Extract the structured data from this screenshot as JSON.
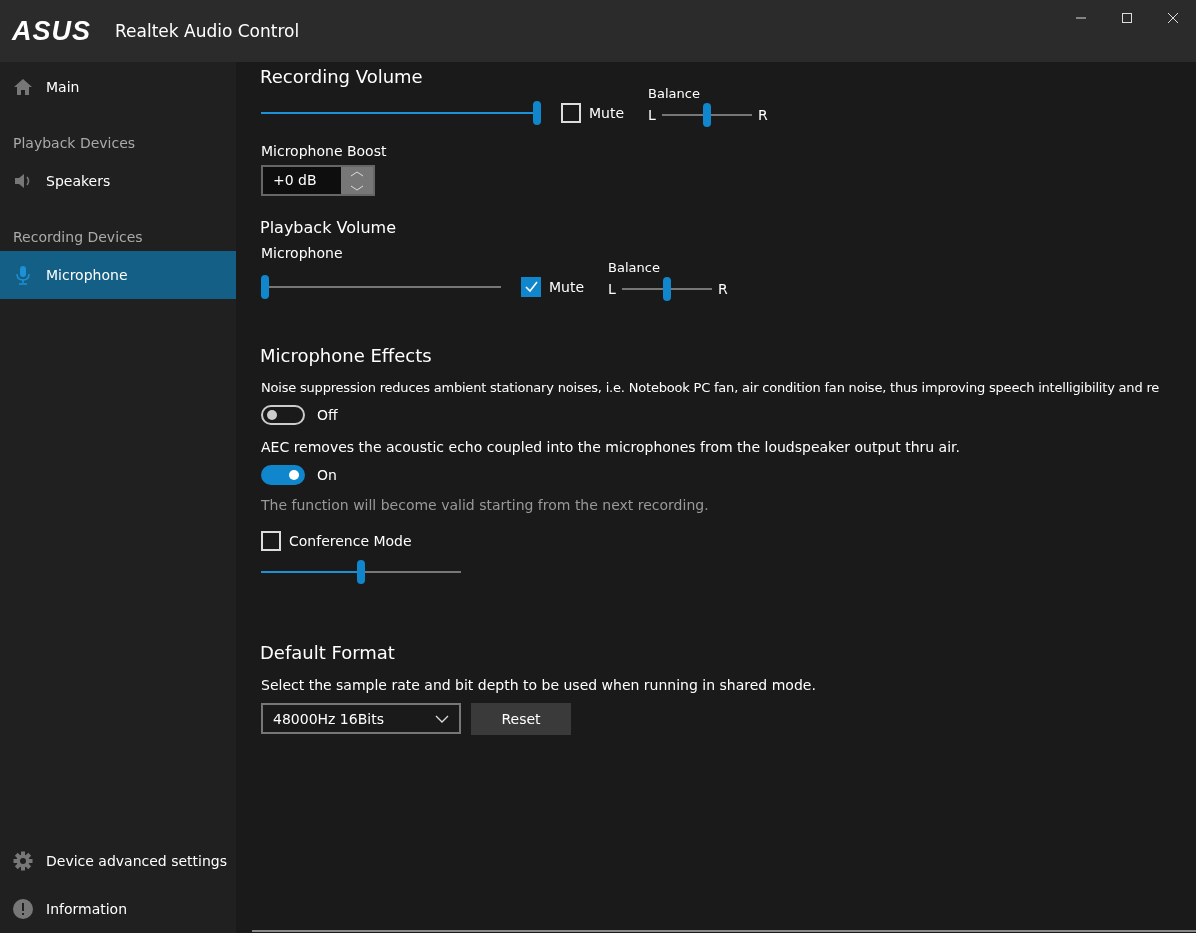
{
  "window": {
    "logo": "ASUS",
    "title": "Realtek Audio Control"
  },
  "sidebar": {
    "items": [
      {
        "kind": "link",
        "label": "Main",
        "selected": false
      },
      {
        "kind": "header",
        "label": "Playback Devices"
      },
      {
        "kind": "link",
        "label": "Speakers",
        "selected": false
      },
      {
        "kind": "header",
        "label": "Recording Devices"
      },
      {
        "kind": "link",
        "label": "Microphone",
        "selected": true
      }
    ],
    "bottom_items": [
      {
        "label": "Device advanced settings",
        "selected": false
      },
      {
        "label": "Information",
        "selected": false
      }
    ]
  },
  "recording_volume": {
    "title": "Recording Volume",
    "level": 1.0,
    "mute": {
      "label": "Mute",
      "checked": false
    },
    "balance": {
      "label": "Balance",
      "left": "L",
      "right": "R",
      "level": 0.5
    },
    "boost": {
      "label": "Microphone Boost",
      "value": "+0 dB"
    }
  },
  "playback_volume": {
    "title": "Playback Volume",
    "channel": "Microphone",
    "level": 0.0,
    "mute": {
      "label": "Mute",
      "checked": true
    },
    "balance": {
      "label": "Balance",
      "left": "L",
      "right": "R",
      "level": 0.5
    }
  },
  "effects": {
    "title": "Microphone Effects",
    "noise_suppression": {
      "description": "Noise suppression reduces ambient stationary noises, i.e. Notebook PC fan, air condition fan noise, thus improving speech intelligibility and re",
      "on": false,
      "state": "Off"
    },
    "aec": {
      "description": "AEC removes the acoustic echo coupled into the microphones from the loudspeaker output thru air.",
      "on": true,
      "state": "On",
      "note": "The function will become valid starting from the next recording."
    },
    "conference": {
      "label": "Conference Mode",
      "checked": false,
      "level": 0.5
    }
  },
  "default_format": {
    "title": "Default Format",
    "description": "Select the sample rate and bit depth to be used when running in shared mode.",
    "value": "48000Hz 16Bits",
    "button": "Reset"
  }
}
